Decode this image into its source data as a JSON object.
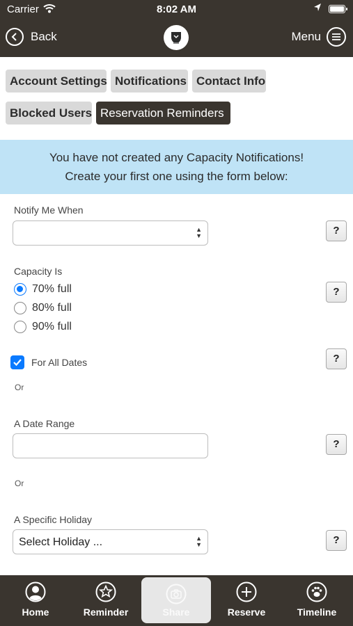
{
  "status_bar": {
    "carrier": "Carrier",
    "time": "8:02 AM"
  },
  "nav": {
    "back_label": "Back",
    "menu_label": "Menu"
  },
  "tabs": [
    "Account Settings",
    "Notifications",
    "Contact Info",
    "Blocked Users",
    "Reservation Reminders"
  ],
  "active_tab": "Reservation Reminders",
  "banner": {
    "line1": "You have not created any Capacity Notifications!",
    "line2": "Create your first one using the form below:"
  },
  "form": {
    "notify_label": "Notify Me When",
    "notify_value": "",
    "capacity_label": "Capacity Is",
    "capacity_options": [
      "70% full",
      "80% full",
      "90% full"
    ],
    "capacity_selected": "70% full",
    "all_dates_label": "For All Dates",
    "all_dates_checked": true,
    "or_1": "Or",
    "date_range_label": "A Date Range",
    "date_range_value": "",
    "or_2": "Or",
    "holiday_label": "A Specific Holiday",
    "holiday_value": "Select Holiday ...",
    "help_label": "?"
  },
  "bottom_nav": [
    {
      "label": "Home",
      "icon": "person-icon"
    },
    {
      "label": "Reminder",
      "icon": "star-icon"
    },
    {
      "label": "Share",
      "icon": "camera-icon"
    },
    {
      "label": "Reserve",
      "icon": "plus-icon"
    },
    {
      "label": "Timeline",
      "icon": "paw-icon"
    }
  ],
  "active_bottom_nav": "Share",
  "colors": {
    "bar": "#3a352f",
    "banner": "#bfe3f6",
    "accent": "#0a7aff",
    "tab": "#d9d9d9"
  }
}
